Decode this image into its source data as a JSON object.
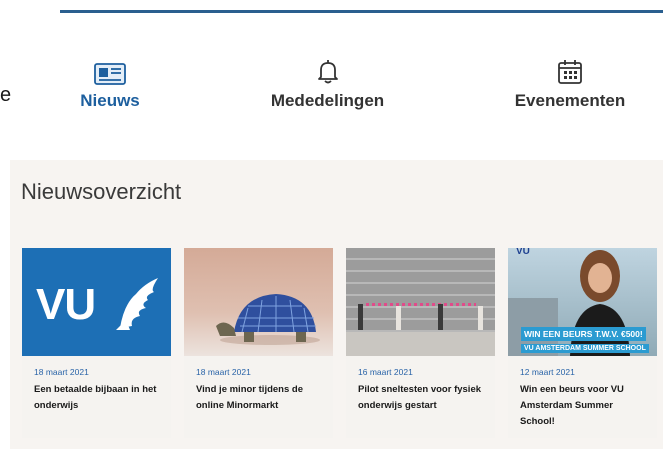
{
  "edge_char": "e",
  "tabs": [
    {
      "label": "Nieuws",
      "icon": "newspaper-icon",
      "active": true
    },
    {
      "label": "Mededelingen",
      "icon": "bell-icon",
      "active": false
    },
    {
      "label": "Evenementen",
      "icon": "calendar-icon",
      "active": false
    }
  ],
  "panel": {
    "title": "Nieuwsoverzicht",
    "cards": [
      {
        "date": "18 maart 2021",
        "headline": "Een betaalde bijbaan in het onderwijs",
        "image": "vu-logo-image",
        "image_text": "VU"
      },
      {
        "date": "18 maart 2021",
        "headline": "Vind je minor tijdens de online Minormarkt",
        "image": "solar-turtle-image"
      },
      {
        "date": "16 maart 2021",
        "headline": "Pilot sneltesten voor fysiek onderwijs gestart",
        "image": "people-distance-wall-image"
      },
      {
        "date": "12 maart 2021",
        "headline": "Win een beurs voor VU Amsterdam Summer School!",
        "image": "summer-school-banner-image",
        "badge_line1": "WIN EEN BEURS T.W.V. €500!",
        "badge_line2": "VU AMSTERDAM SUMMER SCHOOL",
        "corner_text": "VU"
      }
    ]
  },
  "colors": {
    "accent": "#1d5f9e",
    "date": "#2a64a8",
    "vu_blue": "#1d6fb5",
    "panel_bg": "#f7f4f1"
  }
}
